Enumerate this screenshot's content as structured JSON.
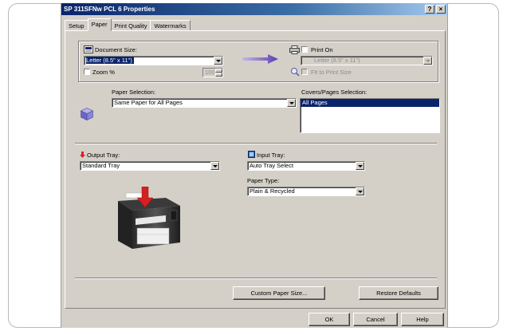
{
  "window": {
    "title": "SP 311SFNw PCL 6 Properties",
    "help_glyph": "?",
    "close_glyph": "×"
  },
  "tabs": [
    "Setup",
    "Paper",
    "Print Quality",
    "Watermarks"
  ],
  "active_tab": "Paper",
  "document_size": {
    "label": "Document Size:",
    "value": "Letter (8.5\" x 11\")",
    "zoom_label": "Zoom %",
    "zoom_value": "100"
  },
  "print_on": {
    "label": "Print On",
    "value": "Letter (8.5\" x 11\")",
    "fit_label": "Fit to Print Size"
  },
  "paper_selection": {
    "label": "Paper Selection:",
    "value": "Same Paper for All Pages"
  },
  "covers_pages": {
    "label": "Covers/Pages Selection:",
    "items": [
      "All Pages"
    ]
  },
  "output_tray": {
    "label": "Output Tray:",
    "value": "Standard Tray"
  },
  "input_tray": {
    "label": "Input Tray:",
    "value": "Auto Tray Select"
  },
  "paper_type": {
    "label": "Paper Type:",
    "value": "Plain & Recycled"
  },
  "buttons": {
    "custom_paper_size": "Custom Paper Size...",
    "restore_defaults": "Restore Defaults",
    "ok": "OK",
    "cancel": "Cancel",
    "help": "Help"
  },
  "colors": {
    "titlebar": "#0a246a",
    "selection": "#0a246a",
    "arrow": "#5a3fb0",
    "output_arrow": "#e02020",
    "dialog_bg": "#d4d0c8"
  },
  "icons": {
    "document_size": "document-size-icon",
    "print_on": "printer-icon",
    "fit": "magnifier-icon",
    "paper_selection": "paper-cube-icon",
    "arrow": "right-arrow-icon",
    "output_tray": "red-down-arrow-icon",
    "input_tray": "input-tray-icon",
    "printer_image": "printer-illustration"
  }
}
